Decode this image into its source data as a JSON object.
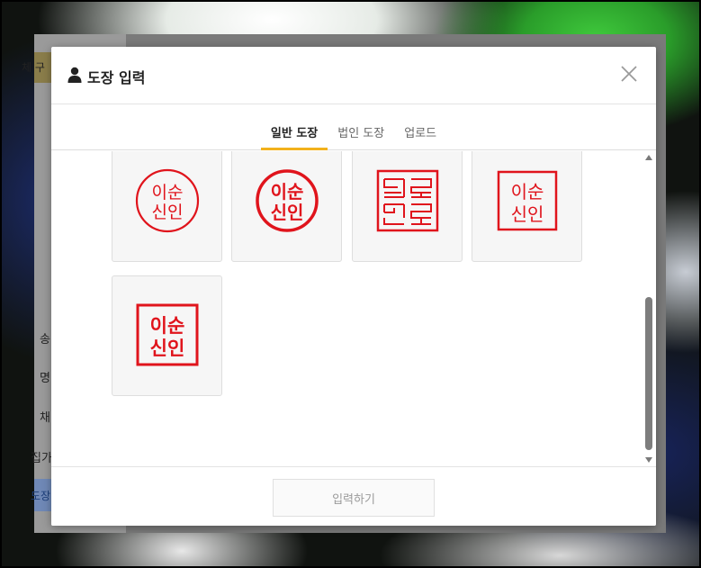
{
  "background_page": {
    "strip_text": "체 구",
    "items": [
      "송",
      "명",
      "채",
      "집가",
      "도장"
    ]
  },
  "modal": {
    "title": "도장 입력",
    "title_icon": "user-icon",
    "close_icon": "close-icon",
    "tabs": [
      {
        "label": "일반 도장",
        "active": true
      },
      {
        "label": "법인 도장",
        "active": false
      },
      {
        "label": "업로드",
        "active": false
      }
    ],
    "stamps": [
      {
        "style": "circle-thin",
        "line1": "이순",
        "line2": "신인"
      },
      {
        "style": "circle-bold",
        "line1": "이순",
        "line2": "신인"
      },
      {
        "style": "square-seal-script",
        "line1": "이순",
        "line2": "신인"
      },
      {
        "style": "square-thin",
        "line1": "이순",
        "line2": "신인"
      },
      {
        "style": "square-bold",
        "line1": "이순",
        "line2": "신인"
      }
    ],
    "submit_label": "입력하기"
  },
  "colors": {
    "accent": "#f2b11c",
    "stamp_red": "#e0141c",
    "scrollbar": "#7d7d7d"
  }
}
